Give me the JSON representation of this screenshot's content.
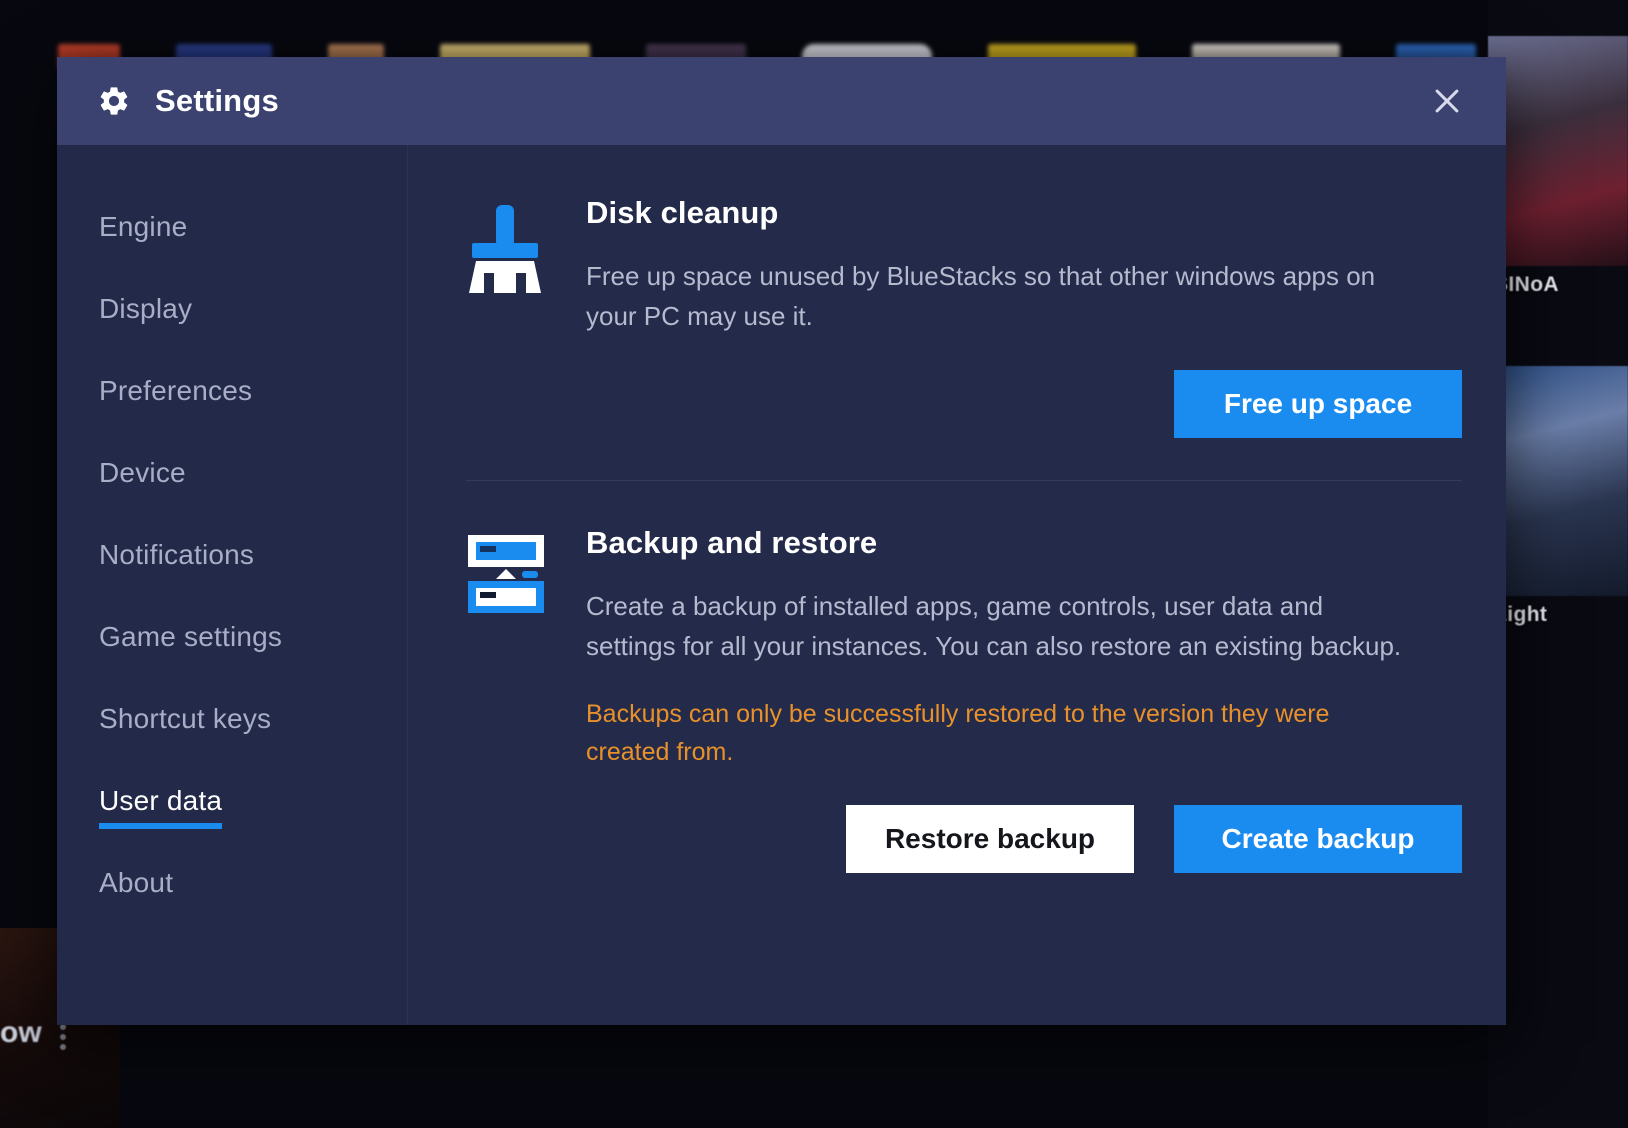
{
  "window": {
    "title": "Settings",
    "gear_icon": "gear-icon",
    "close_icon": "close-icon"
  },
  "sidebar": {
    "items": [
      {
        "label": "Engine",
        "active": false
      },
      {
        "label": "Display",
        "active": false
      },
      {
        "label": "Preferences",
        "active": false
      },
      {
        "label": "Device",
        "active": false
      },
      {
        "label": "Notifications",
        "active": false
      },
      {
        "label": "Game settings",
        "active": false
      },
      {
        "label": "Shortcut keys",
        "active": false
      },
      {
        "label": "User data",
        "active": true
      },
      {
        "label": "About",
        "active": false
      }
    ]
  },
  "sections": {
    "disk_cleanup": {
      "icon": "broom-icon",
      "title": "Disk cleanup",
      "description": "Free up space unused by BlueStacks so that other windows apps on your PC may use it.",
      "button": "Free up space"
    },
    "backup_restore": {
      "icon": "backup-restore-icon",
      "title": "Backup and restore",
      "description": "Create a backup of installed apps, game controls, user data and settings for all your instances. You can also restore an existing backup.",
      "warning": "Backups can only be successfully restored to the version they were created from.",
      "restore_button": "Restore backup",
      "create_button": "Create backup"
    }
  },
  "background": {
    "right_cards": [
      {
        "caption": "SINoA"
      },
      {
        "caption": "Light"
      }
    ],
    "left_label": "ow",
    "menu_icon": "more-vertical-icon"
  },
  "colors": {
    "accent_blue": "#1a8cf0",
    "warning_orange": "#e8912a",
    "modal_bg": "#232a4a",
    "titlebar_bg": "#3b4270",
    "sidebar_bg": "#222949",
    "text_primary": "#ffffff",
    "text_secondary": "#b6bace",
    "text_muted": "#a9aec6"
  }
}
